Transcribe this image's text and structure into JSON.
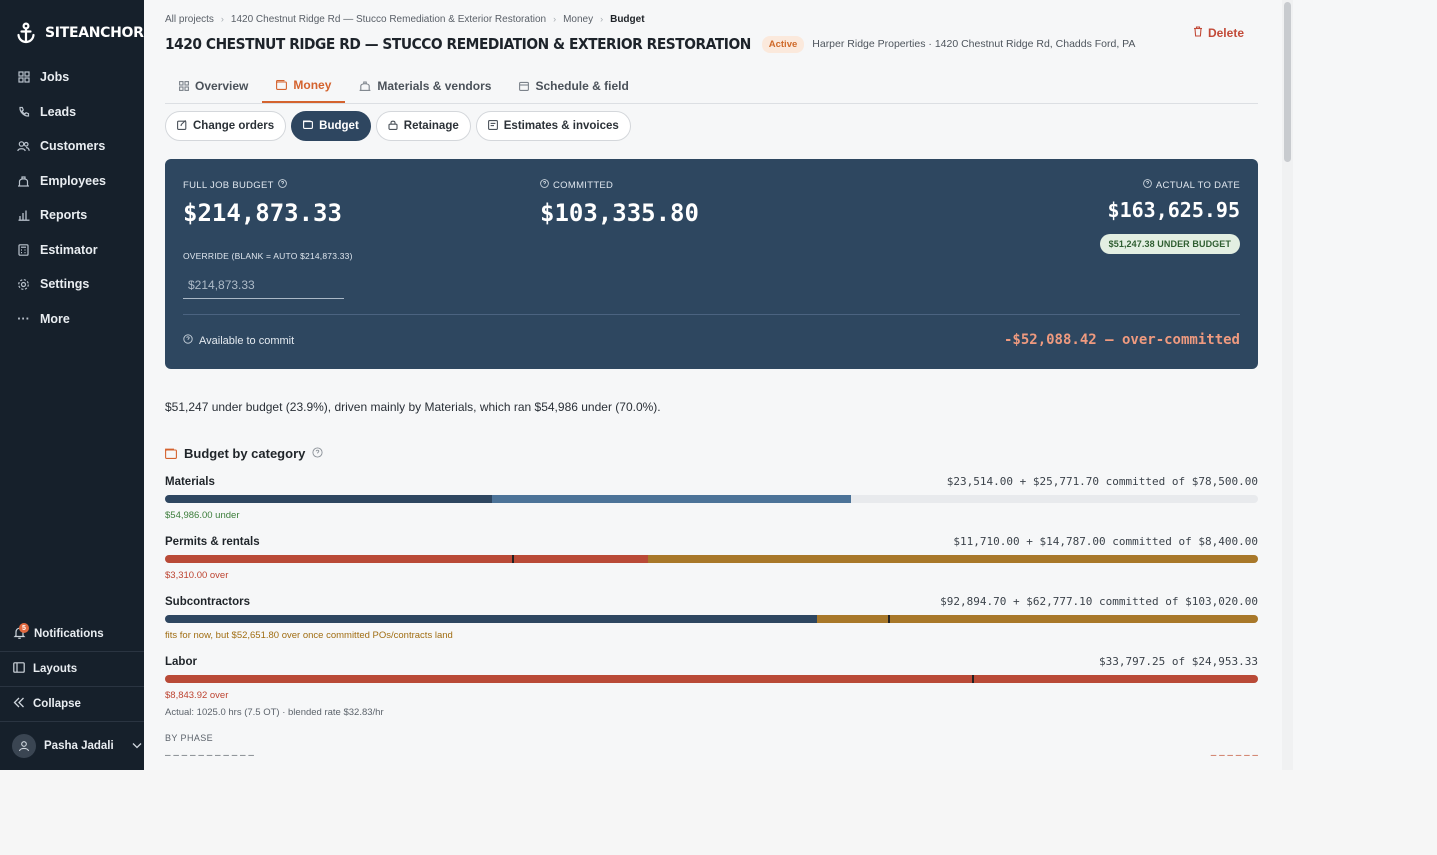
{
  "sidebar": {
    "brand": "SITEANCHOR",
    "items": [
      {
        "label": "Jobs",
        "icon": "grid-icon"
      },
      {
        "label": "Leads",
        "icon": "phone-icon"
      },
      {
        "label": "Customers",
        "icon": "users-icon"
      },
      {
        "label": "Employees",
        "icon": "team-icon"
      },
      {
        "label": "Reports",
        "icon": "bar-chart-icon"
      },
      {
        "label": "Estimator",
        "icon": "calculator-icon"
      },
      {
        "label": "Settings",
        "icon": "gear-icon"
      },
      {
        "label": "More",
        "icon": "ellipsis-icon"
      }
    ],
    "notifications": {
      "label": "Notifications",
      "count": "5"
    },
    "layouts": "Layouts",
    "collapse": "Collapse",
    "user": "Pasha Jadali"
  },
  "breadcrumb": [
    "All projects",
    "1420 Chestnut Ridge Rd — Stucco Remediation & Exterior Restoration",
    "Money",
    "Budget"
  ],
  "header": {
    "title": "1420 CHESTNUT RIDGE RD — STUCCO REMEDIATION & EXTERIOR RESTORATION",
    "status": "Active",
    "owner": "Harper Ridge Properties · 1420 Chestnut Ridge Rd, Chadds Ford, PA",
    "delete_label": "Delete"
  },
  "tabs": [
    {
      "label": "Overview",
      "active": false
    },
    {
      "label": "Money",
      "active": true
    },
    {
      "label": "Materials & vendors",
      "active": false
    },
    {
      "label": "Schedule & field",
      "active": false
    }
  ],
  "subtabs": [
    {
      "label": "Change orders",
      "active": false
    },
    {
      "label": "Budget",
      "active": true
    },
    {
      "label": "Retainage",
      "active": false
    },
    {
      "label": "Estimates & invoices",
      "active": false
    }
  ],
  "budget_card": {
    "full_label": "FULL JOB BUDGET",
    "full_value": "$214,873.33",
    "committed_label": "COMMITTED",
    "committed_value": "$103,335.80",
    "actual_label": "ACTUAL TO DATE",
    "actual_value": "$163,625.95",
    "under_pill": "$51,247.38 UNDER BUDGET",
    "override_label": "OVERRIDE (BLANK = AUTO $214,873.33)",
    "override_placeholder": "$214,873.33",
    "available_label": "Available to commit",
    "available_value": "-$52,088.42 — over-committed"
  },
  "summary": "$51,247 under budget (23.9%), driven mainly by Materials, which ran $54,986 under (70.0%).",
  "categories_title": "Budget by category",
  "categories": [
    {
      "name": "Materials",
      "amount": "$23,514.00 + $25,771.70 committed of $78,500.00",
      "note": "$54,986.00 under"
    },
    {
      "name": "Permits & rentals",
      "amount": "$11,710.00 + $14,787.00 committed of $8,400.00",
      "note": "$3,310.00 over"
    },
    {
      "name": "Subcontractors",
      "amount": "$92,894.70 + $62,777.10 committed of $103,020.00",
      "note": "fits for now, but $52,651.80 over once committed POs/contracts land"
    },
    {
      "name": "Labor",
      "amount": "$33,797.25 of $24,953.33",
      "note": "$8,843.92 over",
      "subnote": "Actual: 1025.0 hrs (7.5 OT) · blended rate $32.83/hr"
    }
  ],
  "by_phase_label": "BY PHASE",
  "colors": {
    "sidebar": "#16202b",
    "accent": "#d4632e",
    "card": "#2e4760",
    "actual": "#2e4660",
    "committed": "#4c7398",
    "over": "#b94a37",
    "amber": "#a8782a"
  }
}
